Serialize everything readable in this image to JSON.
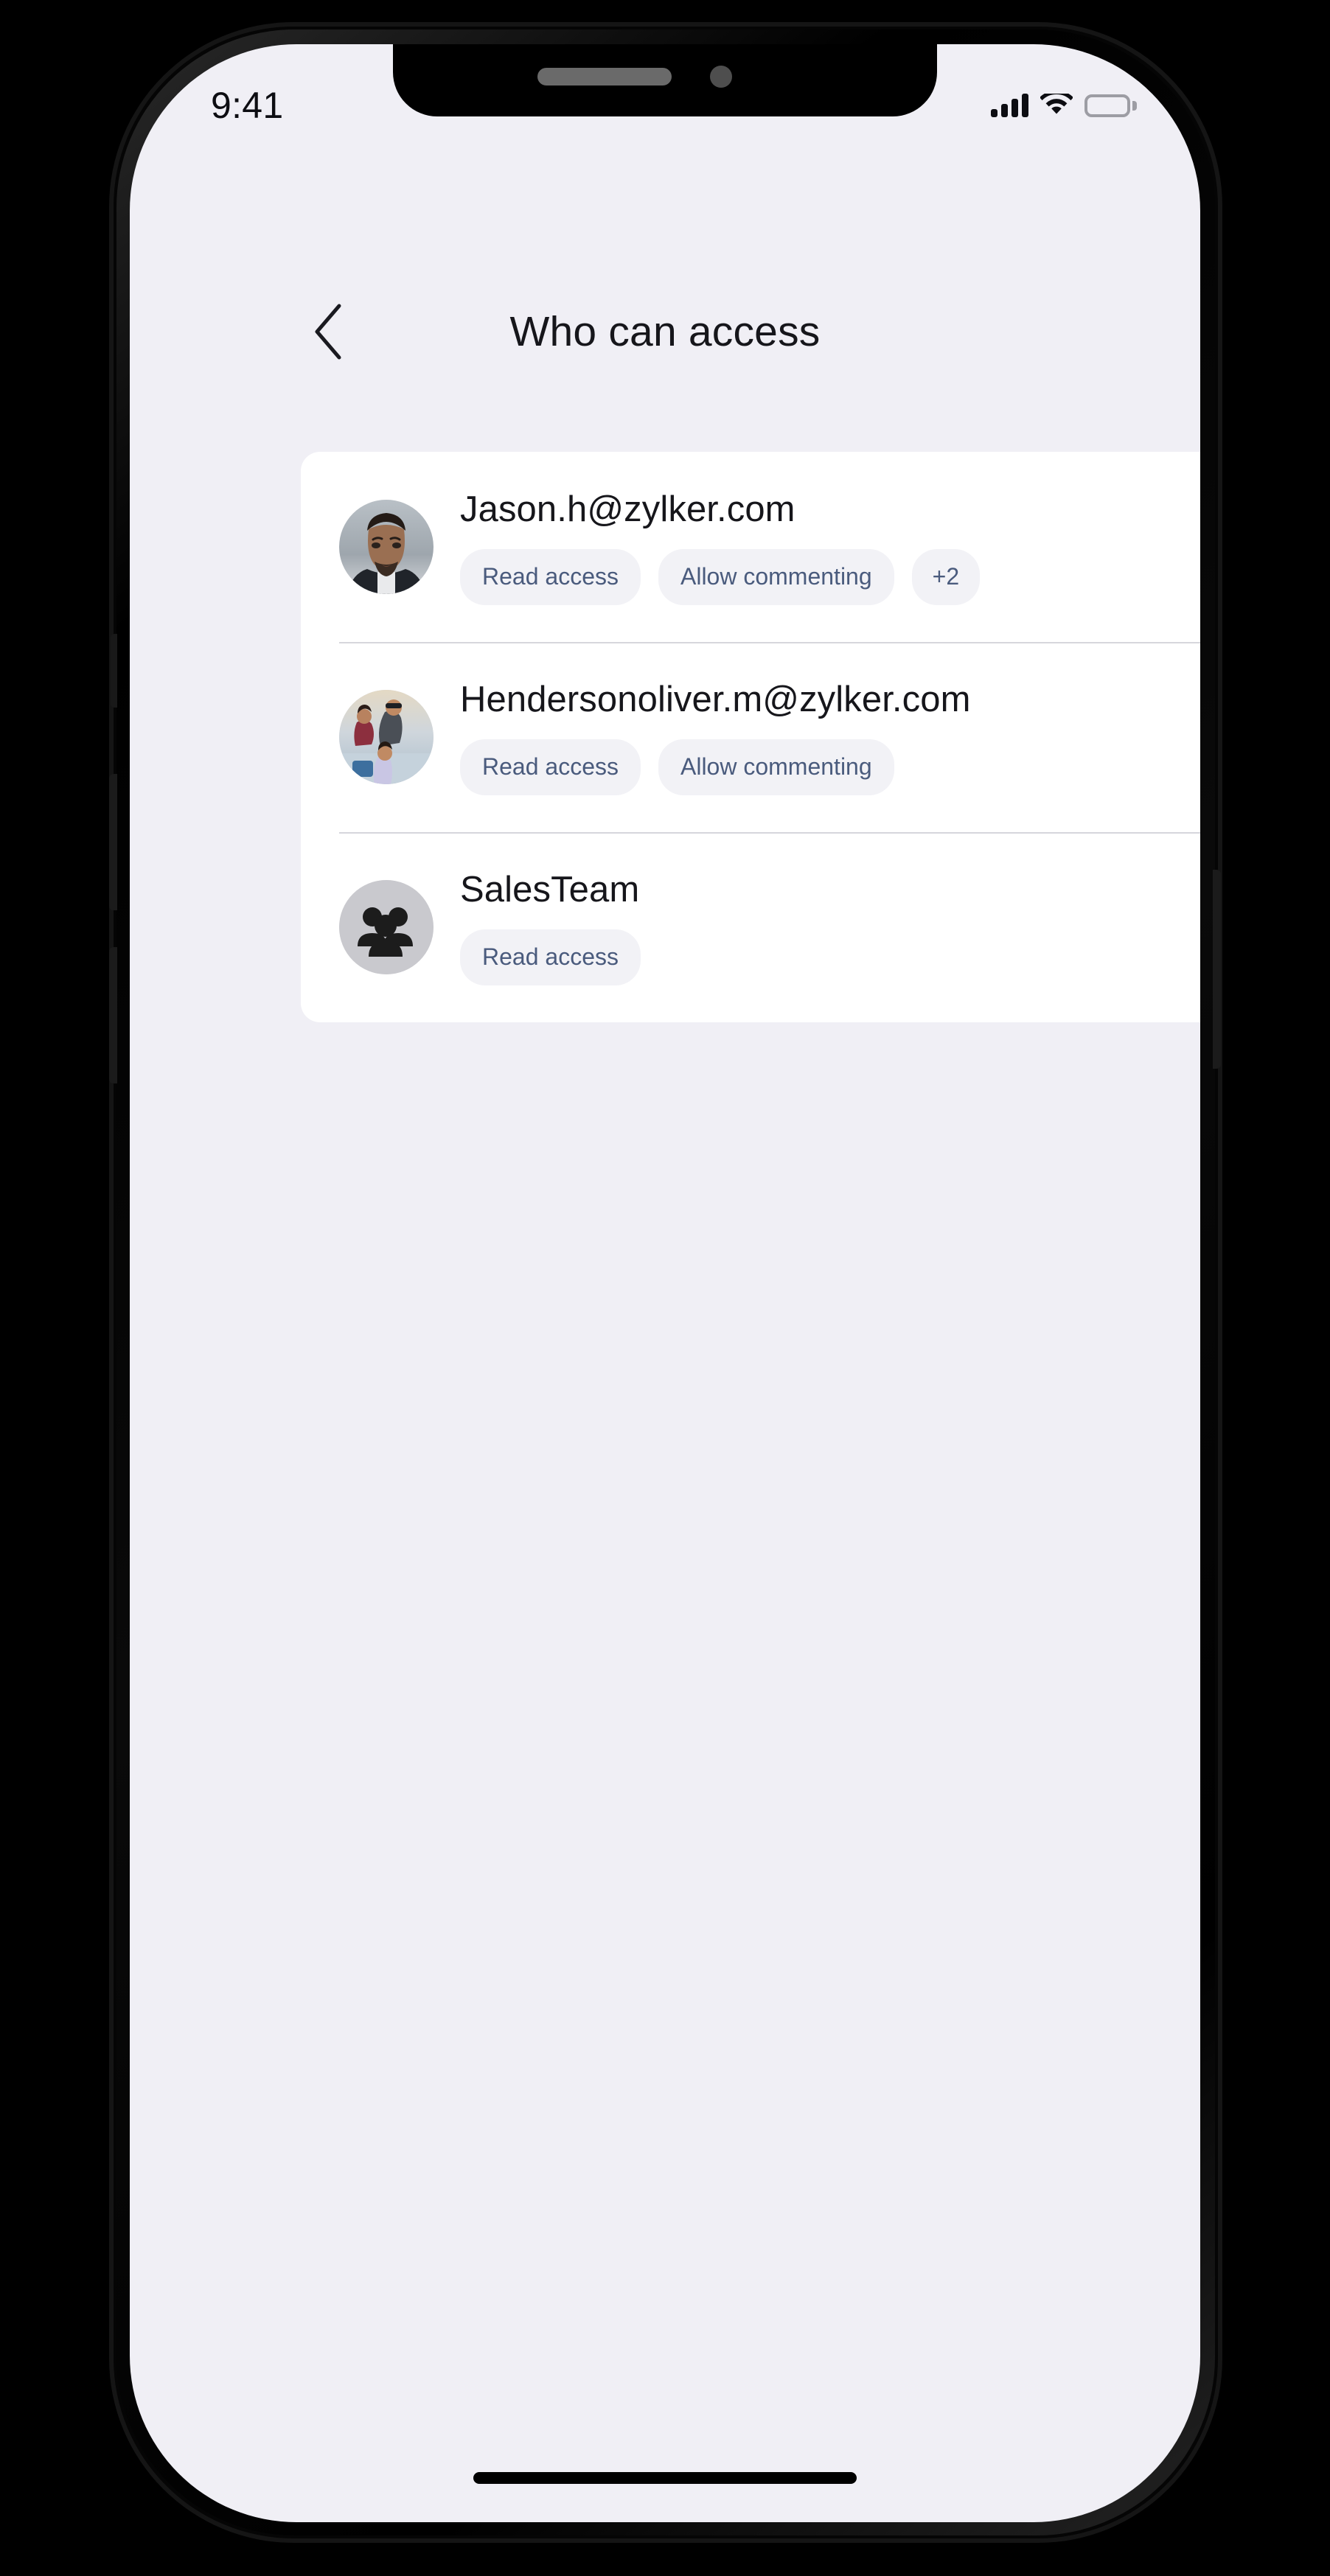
{
  "device": {
    "notch": {
      "speaker_name": "earpiece-speaker",
      "camera_name": "front-camera"
    }
  },
  "status_bar": {
    "time": "9:41",
    "icons": {
      "signal": "cellular-signal-icon",
      "wifi": "wifi-icon",
      "battery": "battery-full-icon"
    }
  },
  "header": {
    "back_icon": "chevron-left-icon",
    "title": "Who can access"
  },
  "access_list": {
    "rows": [
      {
        "name": "Jason.h@zylker.com",
        "avatar_type": "photo",
        "avatar_label": "user-photo-avatar",
        "chips": [
          "Read access",
          "Allow commenting",
          "+2"
        ],
        "chevron": "chevron-right-icon"
      },
      {
        "name": "Hendersonoliver.m@zylker.com",
        "avatar_type": "photo",
        "avatar_label": "user-photo-avatar",
        "chips": [
          "Read access",
          "Allow commenting"
        ],
        "chevron": "chevron-right-icon"
      },
      {
        "name": "SalesTeam",
        "avatar_type": "group",
        "avatar_label": "group-avatar",
        "chips": [
          "Read access"
        ],
        "chevron": "chevron-right-icon"
      }
    ]
  },
  "colors": {
    "screen_background": "#f0eff5",
    "card_background": "#ffffff",
    "chip_background": "#f2f2f6",
    "chip_text": "#4a5b7d",
    "title_text": "#16161b",
    "divider": "#d6d6dc",
    "chevron": "#c8c8cd"
  },
  "home_indicator": "home-indicator-bar"
}
